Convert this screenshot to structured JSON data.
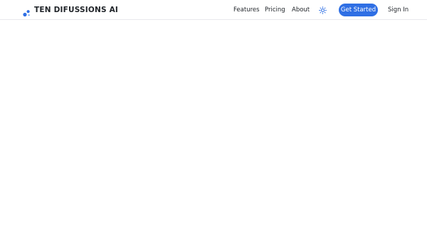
{
  "header": {
    "brand_name": "TEN DIFUSSIONS AI",
    "brand_icon": "sparkle-logo-icon",
    "nav": {
      "features": "Features",
      "pricing": "Pricing",
      "about": "About"
    },
    "theme_toggle_icon": "sun-icon",
    "get_started_label": "Get Started",
    "sign_in_label": "Sign In"
  },
  "colors": {
    "accent": "#2f6fe4",
    "text": "#1f2328",
    "background": "#ffffff",
    "divider": "#e8e8ec"
  }
}
